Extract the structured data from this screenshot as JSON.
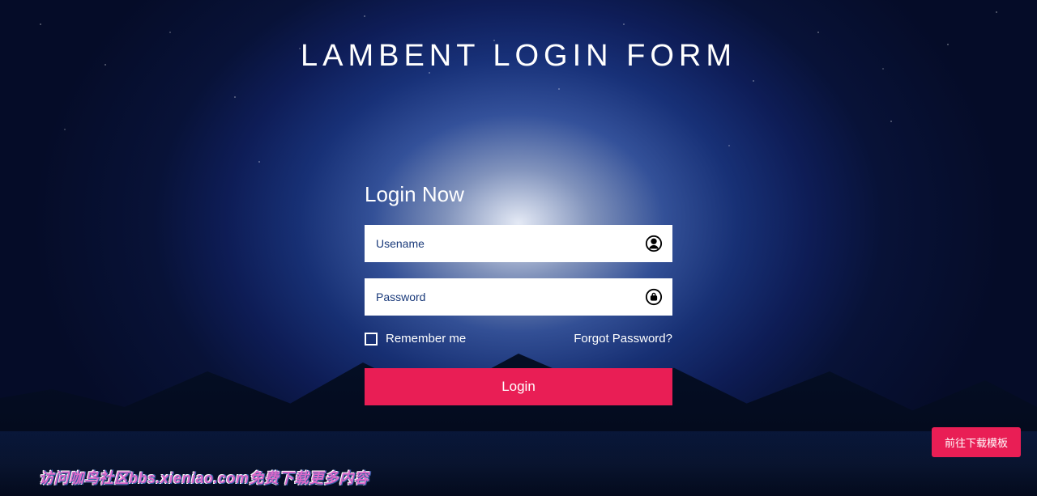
{
  "page": {
    "title": "LAMBENT LOGIN FORM"
  },
  "form": {
    "heading": "Login Now",
    "username_placeholder": "Usename",
    "password_placeholder": "Password",
    "remember_label": "Remember me",
    "forgot_label": "Forgot Password?",
    "submit_label": "Login"
  },
  "buttons": {
    "download_template": "前往下载模板"
  },
  "watermark": {
    "text": "访问咖鸟社区bbs.xieniao.com免费下载更多内容"
  },
  "colors": {
    "accent": "#e91e55",
    "input_placeholder": "#1a3a7a"
  }
}
